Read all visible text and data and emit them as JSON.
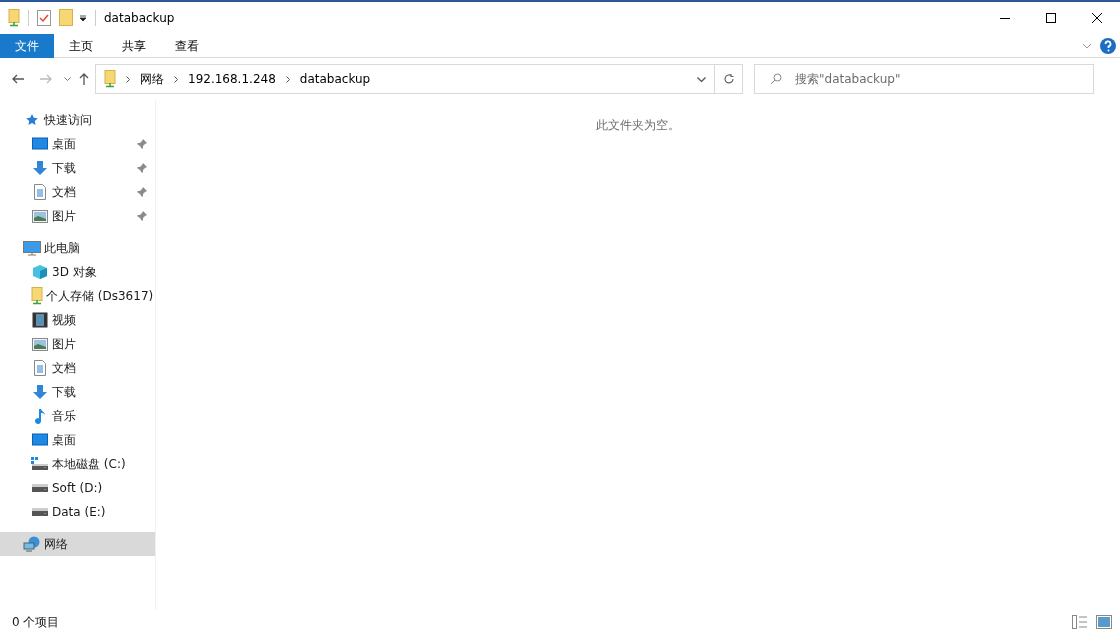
{
  "window": {
    "title": "databackup"
  },
  "ribbon": {
    "tabs": [
      {
        "label": "文件",
        "kind": "file",
        "selected": false
      },
      {
        "label": "主页",
        "kind": "tab",
        "selected": false
      },
      {
        "label": "共享",
        "kind": "tab",
        "selected": false
      },
      {
        "label": "查看",
        "kind": "tab",
        "selected": false
      }
    ]
  },
  "address": {
    "crumbs": [
      "网络",
      "192.168.1.248",
      "databackup"
    ]
  },
  "search": {
    "placeholder": "搜索\"databackup\""
  },
  "sidebar": {
    "items": [
      {
        "label": "快速访问",
        "kind": "star",
        "selected": false,
        "children": [
          {
            "label": "桌面",
            "kind": "desktop",
            "pinned": true,
            "selected": false
          },
          {
            "label": "下载",
            "kind": "download",
            "pinned": true,
            "selected": false
          },
          {
            "label": "文档",
            "kind": "document",
            "pinned": true,
            "selected": false
          },
          {
            "label": "图片",
            "kind": "picture",
            "pinned": true,
            "selected": false
          }
        ]
      },
      {
        "label": "此电脑",
        "kind": "pc",
        "selected": false,
        "children": [
          {
            "label": "3D 对象",
            "kind": "cube",
            "pinned": false,
            "selected": false
          },
          {
            "label": "个人存储 (Ds3617)",
            "kind": "netfolder",
            "pinned": false,
            "selected": false
          },
          {
            "label": "视频",
            "kind": "video",
            "pinned": false,
            "selected": false
          },
          {
            "label": "图片",
            "kind": "picture",
            "pinned": false,
            "selected": false
          },
          {
            "label": "文档",
            "kind": "document",
            "pinned": false,
            "selected": false
          },
          {
            "label": "下载",
            "kind": "download",
            "pinned": false,
            "selected": false
          },
          {
            "label": "音乐",
            "kind": "music",
            "pinned": false,
            "selected": false
          },
          {
            "label": "桌面",
            "kind": "desktop",
            "pinned": false,
            "selected": false
          },
          {
            "label": "本地磁盘 (C:)",
            "kind": "sysdrive",
            "pinned": false,
            "selected": false
          },
          {
            "label": "Soft (D:)",
            "kind": "drive",
            "pinned": false,
            "selected": false
          },
          {
            "label": "Data (E:)",
            "kind": "drive",
            "pinned": false,
            "selected": false
          }
        ]
      },
      {
        "label": "网络",
        "kind": "network",
        "selected": true
      }
    ]
  },
  "content": {
    "empty_message": "此文件夹为空。"
  },
  "status_bar": {
    "count": "0 个项目"
  }
}
